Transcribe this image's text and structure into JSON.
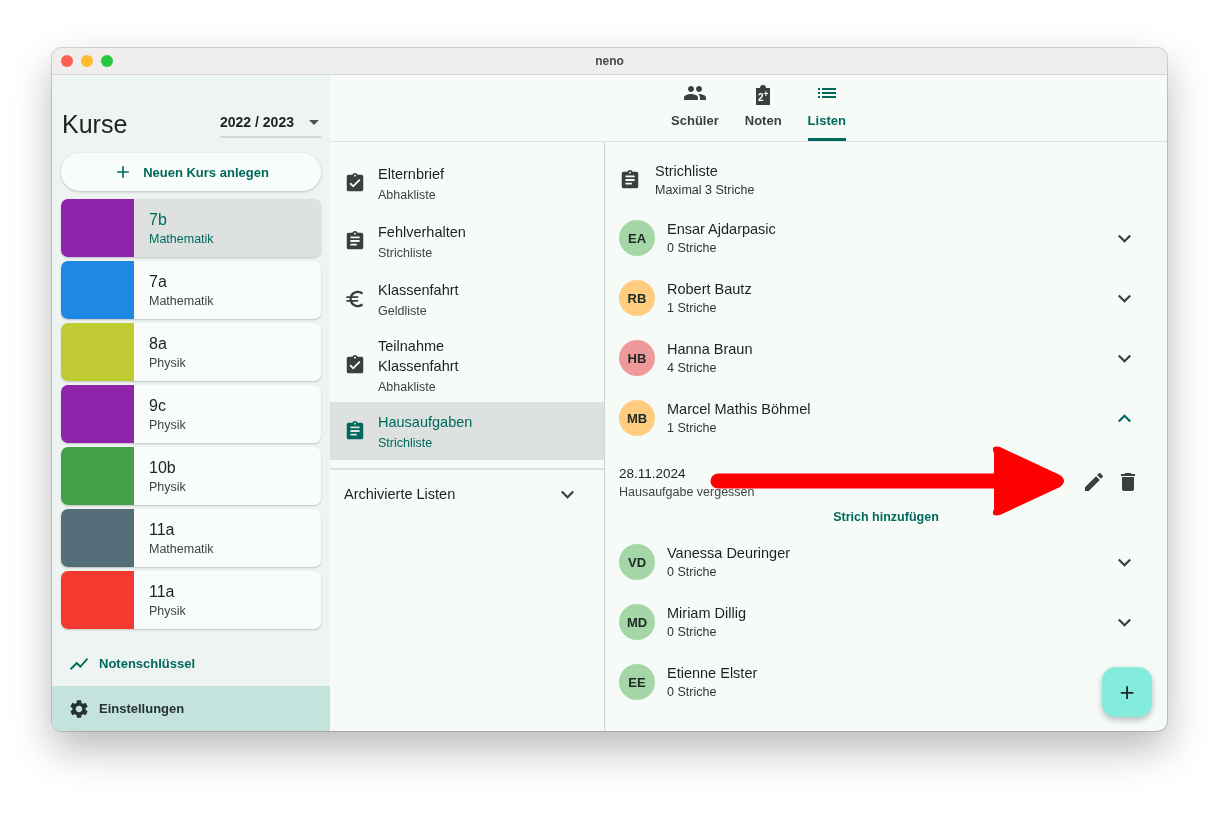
{
  "window": {
    "title": "neno"
  },
  "sidebar": {
    "title": "Kurse",
    "year": "2022 / 2023",
    "new_course_button": "Neuen Kurs anlegen",
    "courses": [
      {
        "name": "7b",
        "subject": "Mathematik",
        "color": "#8e24aa",
        "selected": true
      },
      {
        "name": "7a",
        "subject": "Mathematik",
        "color": "#1e88e5",
        "selected": false
      },
      {
        "name": "8a",
        "subject": "Physik",
        "color": "#c0ca33",
        "selected": false
      },
      {
        "name": "9c",
        "subject": "Physik",
        "color": "#8e24aa",
        "selected": false
      },
      {
        "name": "10b",
        "subject": "Physik",
        "color": "#43a047",
        "selected": false
      },
      {
        "name": "11a",
        "subject": "Mathematik",
        "color": "#546e7a",
        "selected": false
      },
      {
        "name": "11a",
        "subject": "Physik",
        "color": "#f4392e",
        "selected": false
      }
    ],
    "footer": [
      {
        "label": "Notenschlüssel",
        "kind": "chart",
        "selected": false
      },
      {
        "label": "Einstellungen",
        "kind": "settings",
        "selected": true
      }
    ]
  },
  "tabs": [
    {
      "label": "Schüler",
      "kind": "people",
      "selected": false
    },
    {
      "label": "Noten",
      "kind": "grade",
      "icon_text": "2$^{+}$",
      "selected": false
    },
    {
      "label": "Listen",
      "kind": "list",
      "selected": true
    }
  ],
  "lists": [
    {
      "title": "Elternbrief",
      "type": "Abhakliste",
      "kind": "check",
      "selected": false
    },
    {
      "title": "Fehlverhalten",
      "type": "Strichliste",
      "kind": "tally",
      "selected": false
    },
    {
      "title": "Klassenfahrt",
      "type": "Geldliste",
      "kind": "money",
      "selected": false
    },
    {
      "title": "Teilnahme Klassenfahrt",
      "type": "Abhakliste",
      "kind": "check",
      "selected": false
    },
    {
      "title": "Hausaufgaben",
      "type": "Strichliste",
      "kind": "tally",
      "selected": true
    }
  ],
  "archived": {
    "label": "Archivierte Listen",
    "expanded": false
  },
  "detail": {
    "title": "Strichliste",
    "subtitle": "Maximal 3 Striche",
    "students": [
      {
        "initials": "EA",
        "name": "Ensar Ajdarpasic",
        "count": "0 Striche",
        "color": "#a5d6a7",
        "expanded": false
      },
      {
        "initials": "RB",
        "name": "Robert Bautz",
        "count": "1 Striche",
        "color": "#ffcc80",
        "expanded": false
      },
      {
        "initials": "HB",
        "name": "Hanna Braun",
        "count": "4 Striche",
        "color": "#ef9a9a",
        "expanded": false
      },
      {
        "initials": "MB",
        "name": "Marcel Mathis Böhmel",
        "count": "1 Striche",
        "color": "#ffcc80",
        "expanded": true,
        "entries": [
          {
            "date": "28.11.2024",
            "note": "Hausaufgabe vergessen"
          }
        ],
        "add_button": "Strich hinzufügen"
      },
      {
        "initials": "VD",
        "name": "Vanessa Deuringer",
        "count": "0 Striche",
        "color": "#a5d6a7",
        "expanded": false
      },
      {
        "initials": "MD",
        "name": "Miriam Dillig",
        "count": "0 Striche",
        "color": "#a5d6a7",
        "expanded": false
      },
      {
        "initials": "EE",
        "name": "Etienne Elster",
        "count": "0 Striche",
        "color": "#a5d6a7"
      }
    ]
  },
  "fab": {
    "label": "+"
  }
}
